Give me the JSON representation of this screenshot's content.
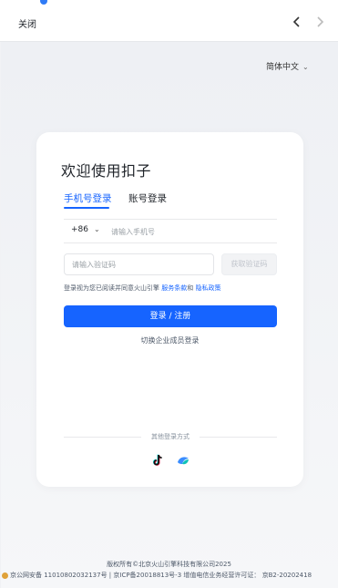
{
  "topbar": {
    "close_label": "关闭"
  },
  "language": {
    "label": "简体中文"
  },
  "card": {
    "title": "欢迎使用扣子",
    "tabs": [
      {
        "label": "手机号登录",
        "active": true
      },
      {
        "label": "账号登录",
        "active": false
      }
    ],
    "phone": {
      "country_code": "+86",
      "placeholder": "请输入手机号"
    },
    "code": {
      "placeholder": "请输入验证码",
      "get_code_label": "获取验证码"
    },
    "agreement": {
      "prefix": "登录视为您已阅读并同意火山引擎",
      "terms_link": "服务条款",
      "and": "和",
      "privacy_link": "隐私政策"
    },
    "login_button": "登录 / 注册",
    "switch_enterprise": "切换企业成员登录",
    "other_methods": "其他登录方式"
  },
  "footer": {
    "copyright": "版权所有©北京火山引擎科技有限公司2025",
    "icp": "京公网安备 11010802032137号 | 京ICP备20018813号-3    增值电信业务经营许可证：  京B2-20202418"
  },
  "colors": {
    "accent": "#1664ff",
    "background": "#f1f2f5",
    "card": "#ffffff"
  },
  "icons": [
    "chevron-left-icon",
    "chevron-right-icon",
    "chevron-down-icon",
    "tiktok-icon",
    "volcengine-icon",
    "police-badge-icon"
  ]
}
